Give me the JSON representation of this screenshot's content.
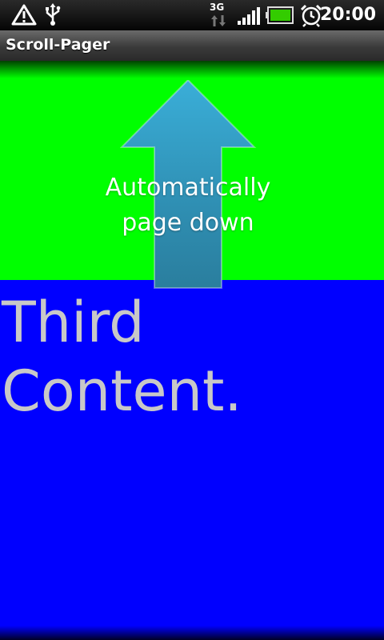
{
  "status_bar": {
    "time": "20:00",
    "network": "3G",
    "icons": [
      "warning-icon",
      "usb-icon",
      "3g-data-icon",
      "signal-icon",
      "battery-icon",
      "alarm-icon"
    ]
  },
  "title_bar": {
    "title": "Scroll-Pager"
  },
  "overlay": {
    "hint": "Automatically page down",
    "icon": "arrow-up-icon"
  },
  "pages": {
    "top_color": "#00ff00",
    "current_color": "#0000ff",
    "current_text": "Third Content."
  }
}
